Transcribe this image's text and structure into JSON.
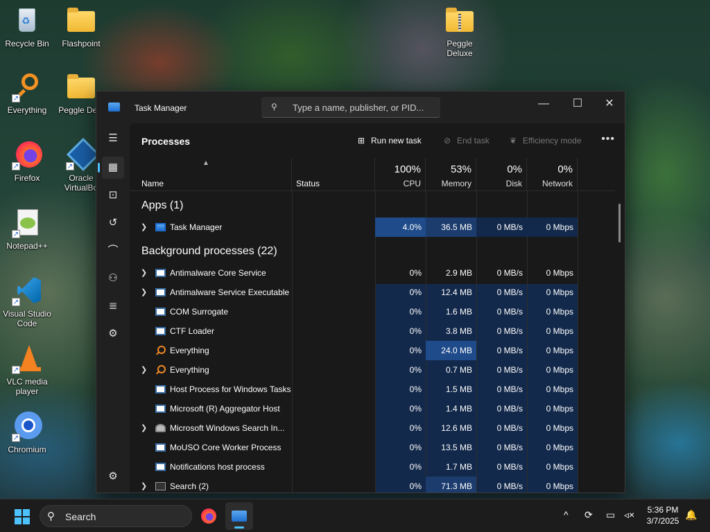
{
  "desktop": {
    "icons": [
      {
        "label": "Recycle Bin",
        "icon": "recycle-bin-icon"
      },
      {
        "label": "Flashpoint",
        "icon": "folder-icon"
      },
      {
        "label": "Peggle Deluxe",
        "icon": "zip-folder-icon"
      },
      {
        "label": "Everything",
        "icon": "everything-search-icon"
      },
      {
        "label": "Peggle Delu",
        "icon": "folder-icon"
      },
      {
        "label": "Firefox",
        "icon": "firefox-icon"
      },
      {
        "label": "Oracle VirtualBo",
        "icon": "virtualbox-icon"
      },
      {
        "label": "Notepad++",
        "icon": "notepadpp-icon"
      },
      {
        "label": "Visual Studio Code",
        "icon": "vscode-icon"
      },
      {
        "label": "VLC media player",
        "icon": "vlc-icon"
      },
      {
        "label": "Chromium",
        "icon": "chromium-icon"
      }
    ]
  },
  "window": {
    "title": "Task Manager",
    "search_placeholder": "Type a name, publisher, or PID...",
    "controls": {
      "minimize": "—",
      "maximize": "☐",
      "close": "✕"
    }
  },
  "sidebar": {
    "items": [
      {
        "name": "hamburger-menu",
        "glyph": "☰"
      },
      {
        "name": "processes",
        "glyph": "▦",
        "active": true
      },
      {
        "name": "performance",
        "glyph": "⊡"
      },
      {
        "name": "app-history",
        "glyph": "↺"
      },
      {
        "name": "startup-apps",
        "glyph": "⌒"
      },
      {
        "name": "users",
        "glyph": "⚇"
      },
      {
        "name": "details",
        "glyph": "≣"
      },
      {
        "name": "services",
        "glyph": "⚙"
      }
    ],
    "settings_glyph": "⚙"
  },
  "commandbar": {
    "page_title": "Processes",
    "run_new_task": "Run new task",
    "end_task": "End task",
    "efficiency_mode": "Efficiency mode",
    "more": "•••"
  },
  "columns": {
    "name": "Name",
    "status": "Status",
    "cpu": {
      "pct": "100%",
      "label": "CPU"
    },
    "memory": {
      "pct": "53%",
      "label": "Memory"
    },
    "disk": {
      "pct": "0%",
      "label": "Disk"
    },
    "network": {
      "pct": "0%",
      "label": "Network"
    }
  },
  "groups": {
    "apps": "Apps (1)",
    "background": "Background processes (22)"
  },
  "apps": [
    {
      "name": "Task Manager",
      "expandable": true,
      "cpu": "4.0%",
      "memory": "36.5 MB",
      "disk": "0 MB/s",
      "network": "0 Mbps",
      "icon": "task-manager-icon"
    }
  ],
  "background": [
    {
      "name": "Antimalware Core Service",
      "expandable": true,
      "cpu": "0%",
      "memory": "2.9 MB",
      "disk": "0 MB/s",
      "network": "0 Mbps",
      "icon": "window-icon"
    },
    {
      "name": "Antimalware Service Executable",
      "expandable": true,
      "cpu": "0%",
      "memory": "12.4 MB",
      "disk": "0 MB/s",
      "network": "0 Mbps",
      "icon": "window-icon"
    },
    {
      "name": "COM Surrogate",
      "expandable": false,
      "cpu": "0%",
      "memory": "1.6 MB",
      "disk": "0 MB/s",
      "network": "0 Mbps",
      "icon": "window-icon"
    },
    {
      "name": "CTF Loader",
      "expandable": false,
      "cpu": "0%",
      "memory": "3.8 MB",
      "disk": "0 MB/s",
      "network": "0 Mbps",
      "icon": "window-icon"
    },
    {
      "name": "Everything",
      "expandable": false,
      "cpu": "0%",
      "memory": "24.0 MB",
      "disk": "0 MB/s",
      "network": "0 Mbps",
      "icon": "everything-icon"
    },
    {
      "name": "Everything",
      "expandable": true,
      "cpu": "0%",
      "memory": "0.7 MB",
      "disk": "0 MB/s",
      "network": "0 Mbps",
      "icon": "everything-icon"
    },
    {
      "name": "Host Process for Windows Tasks",
      "expandable": false,
      "cpu": "0%",
      "memory": "1.5 MB",
      "disk": "0 MB/s",
      "network": "0 Mbps",
      "icon": "window-icon"
    },
    {
      "name": "Microsoft (R) Aggregator Host",
      "expandable": false,
      "cpu": "0%",
      "memory": "1.4 MB",
      "disk": "0 MB/s",
      "network": "0 Mbps",
      "icon": "window-icon"
    },
    {
      "name": "Microsoft Windows Search In...",
      "expandable": true,
      "cpu": "0%",
      "memory": "12.6 MB",
      "disk": "0 MB/s",
      "network": "0 Mbps",
      "icon": "windows-search-icon"
    },
    {
      "name": "MoUSO Core Worker Process",
      "expandable": false,
      "cpu": "0%",
      "memory": "13.5 MB",
      "disk": "0 MB/s",
      "network": "0 Mbps",
      "icon": "window-icon"
    },
    {
      "name": "Notifications host process",
      "expandable": false,
      "cpu": "0%",
      "memory": "1.7 MB",
      "disk": "0 MB/s",
      "network": "0 Mbps",
      "icon": "window-icon"
    },
    {
      "name": "Search (2)",
      "expandable": true,
      "cpu": "0%",
      "memory": "71.3 MB",
      "disk": "0 MB/s",
      "network": "0 Mbps",
      "icon": "search-process-icon"
    }
  ],
  "taskbar": {
    "search_label": "Search",
    "pinned": [
      "firefox-icon",
      "task-manager-icon"
    ],
    "tray": {
      "chevron": "^",
      "time": "5:36 PM",
      "date": "3/7/2025"
    }
  },
  "colors": {
    "accent": "#4cc2ff",
    "heat_low": "#13294b",
    "heat_mid": "#1c3c6e",
    "heat_high": "#1f4b8a"
  }
}
